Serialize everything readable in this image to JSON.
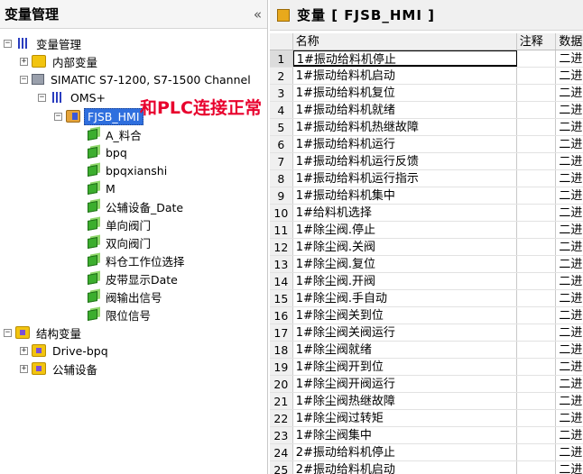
{
  "left_panel": {
    "title": "变量管理",
    "collapse_symbol": "«",
    "tree": [
      {
        "label": "变量管理",
        "icon": "tag-manager-icon",
        "expand": "−"
      },
      {
        "label": "内部变量",
        "icon": "internal-tags-icon",
        "expand": "+"
      },
      {
        "label": "SIMATIC S7-1200, S7-1500 Channel",
        "icon": "channel-icon",
        "expand": "−"
      },
      {
        "label": "OMS+",
        "icon": "device-icon",
        "expand": "−"
      },
      {
        "label": "FJSB_HMI",
        "icon": "tag-group-icon",
        "expand": "−"
      },
      {
        "label": "A_料合",
        "icon": "tag-icon"
      },
      {
        "label": "bpq",
        "icon": "tag-icon"
      },
      {
        "label": "bpqxianshi",
        "icon": "tag-icon"
      },
      {
        "label": "M",
        "icon": "tag-icon"
      },
      {
        "label": "公辅设备_Date",
        "icon": "tag-icon"
      },
      {
        "label": "单向阀门",
        "icon": "tag-icon"
      },
      {
        "label": "双向阀门",
        "icon": "tag-icon"
      },
      {
        "label": "料仓工作位选择",
        "icon": "tag-icon"
      },
      {
        "label": "皮带显示Date",
        "icon": "tag-icon"
      },
      {
        "label": "阀输出信号",
        "icon": "tag-icon"
      },
      {
        "label": "限位信号",
        "icon": "tag-icon"
      },
      {
        "label": "结构变量",
        "icon": "struct-tags-icon",
        "expand": "−"
      },
      {
        "label": "Drive-bpq",
        "icon": "struct-icon",
        "expand": "+"
      },
      {
        "label": "公辅设备",
        "icon": "struct-icon",
        "expand": "+"
      }
    ],
    "annotation": "和PLC连接正常"
  },
  "right_panel": {
    "title": "变量 [ FJSB_HMI ]",
    "columns": [
      "名称",
      "注释",
      "数据"
    ],
    "type_value": "二进",
    "rows": [
      {
        "num": "1",
        "name": "1#振动给料机停止"
      },
      {
        "num": "2",
        "name": "1#振动给料机启动"
      },
      {
        "num": "3",
        "name": "1#振动给料机复位"
      },
      {
        "num": "4",
        "name": "1#振动给料机就绪"
      },
      {
        "num": "5",
        "name": "1#振动给料机热继故障"
      },
      {
        "num": "6",
        "name": "1#振动给料机运行"
      },
      {
        "num": "7",
        "name": "1#振动给料机运行反馈"
      },
      {
        "num": "8",
        "name": "1#振动给料机运行指示"
      },
      {
        "num": "9",
        "name": "1#振动给料机集中"
      },
      {
        "num": "10",
        "name": "1#给料机选择"
      },
      {
        "num": "11",
        "name": "1#除尘阀.停止"
      },
      {
        "num": "12",
        "name": "1#除尘阀.关阀"
      },
      {
        "num": "13",
        "name": "1#除尘阀.复位"
      },
      {
        "num": "14",
        "name": "1#除尘阀.开阀"
      },
      {
        "num": "15",
        "name": "1#除尘阀.手自动"
      },
      {
        "num": "16",
        "name": "1#除尘阀关到位"
      },
      {
        "num": "17",
        "name": "1#除尘阀关阀运行"
      },
      {
        "num": "18",
        "name": "1#除尘阀就绪"
      },
      {
        "num": "19",
        "name": "1#除尘阀开到位"
      },
      {
        "num": "20",
        "name": "1#除尘阀开阀运行"
      },
      {
        "num": "21",
        "name": "1#除尘阀热继故障"
      },
      {
        "num": "22",
        "name": "1#除尘阀过转矩"
      },
      {
        "num": "23",
        "name": "1#除尘阀集中"
      },
      {
        "num": "24",
        "name": "2#振动给料机停止"
      },
      {
        "num": "25",
        "name": "2#振动给料机启动"
      }
    ]
  }
}
